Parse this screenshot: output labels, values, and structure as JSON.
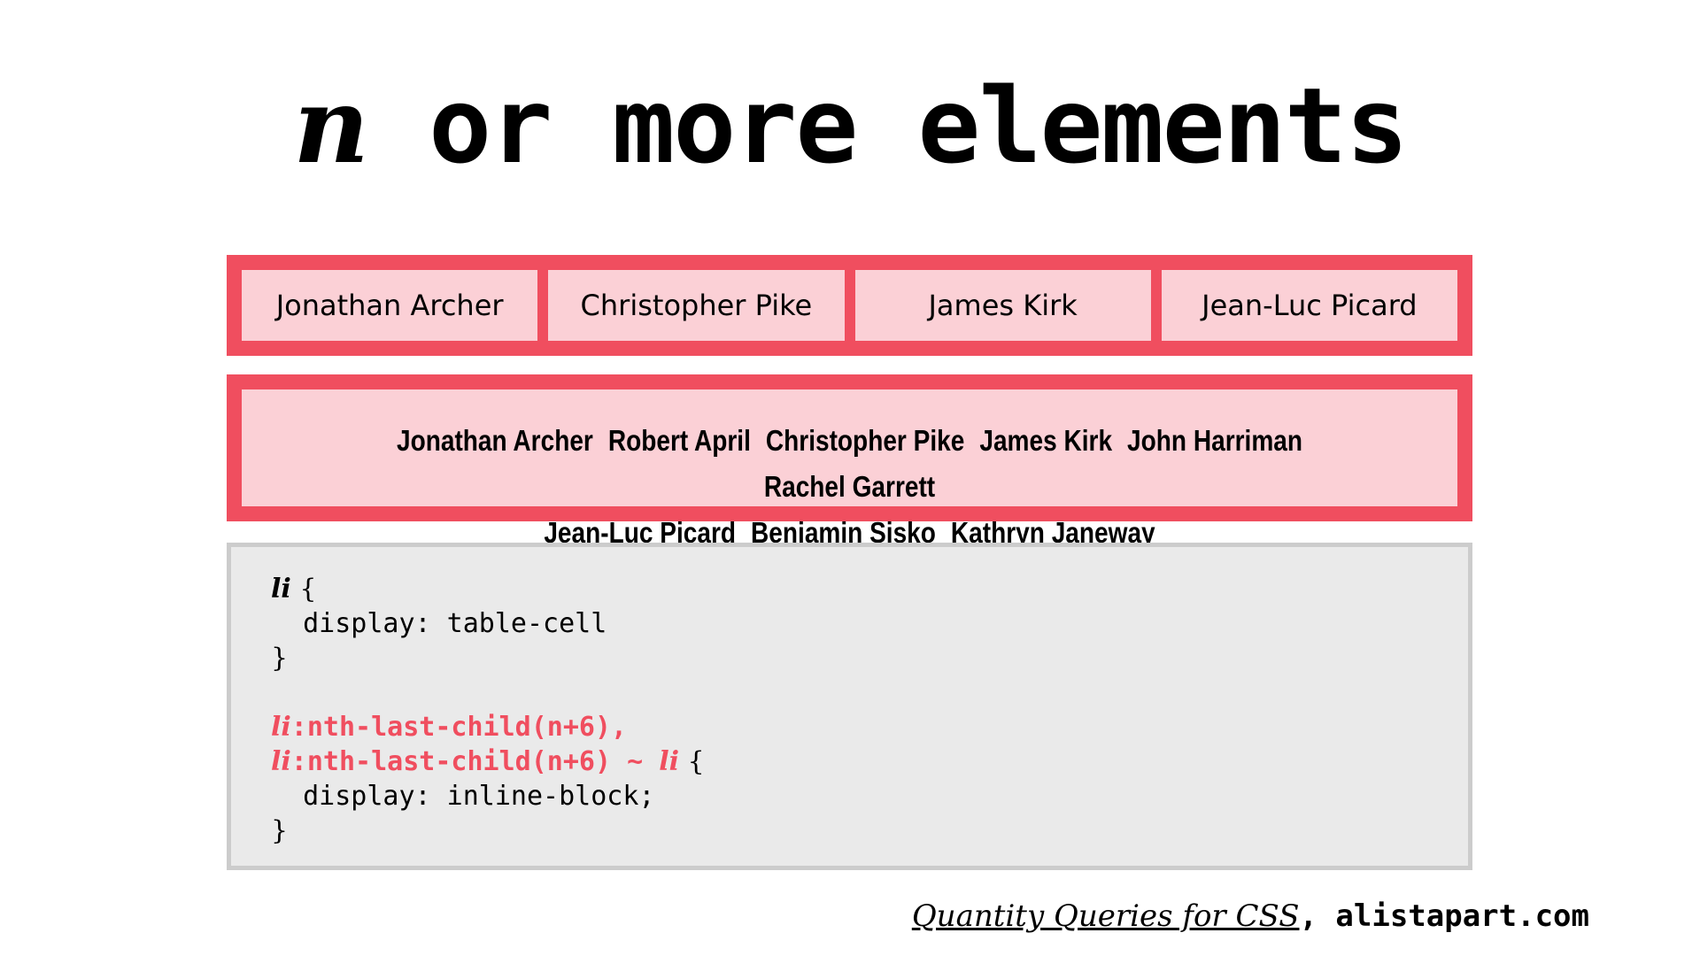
{
  "title": {
    "variable": "n",
    "rest": " or more elements"
  },
  "colors": {
    "accent": "#f04e5f",
    "cell_bg": "#fbd0d6",
    "code_bg": "#eaeaea",
    "code_border": "#cccccc"
  },
  "table_layout": {
    "items": [
      "Jonathan Archer",
      "Christopher Pike",
      "James Kirk",
      "Jean-Luc Picard"
    ]
  },
  "inline_layout": {
    "row1": [
      "Jonathan Archer",
      "Robert April",
      "Christopher Pike",
      "James Kirk",
      "John Harriman",
      "Rachel Garrett"
    ],
    "row2": [
      "Jean-Luc Picard",
      "Benjamin Sisko",
      "Kathryn Janeway"
    ]
  },
  "code": {
    "l1_sel": "li",
    "l1_brace": " {",
    "l2": "  display: table-cell",
    "l3": "}",
    "l5_sel": "li",
    "l5_rest": ":nth-last-child(n+6),",
    "l6_sel": "li",
    "l6_mid": ":nth-last-child(n+6) ~ ",
    "l6_sel2": "li",
    "l6_brace": " {",
    "l7": "  display: inline-block;",
    "l8": "}"
  },
  "footer": {
    "link_text": "Quantity Queries for CSS",
    "rest": ", alistapart.com"
  }
}
